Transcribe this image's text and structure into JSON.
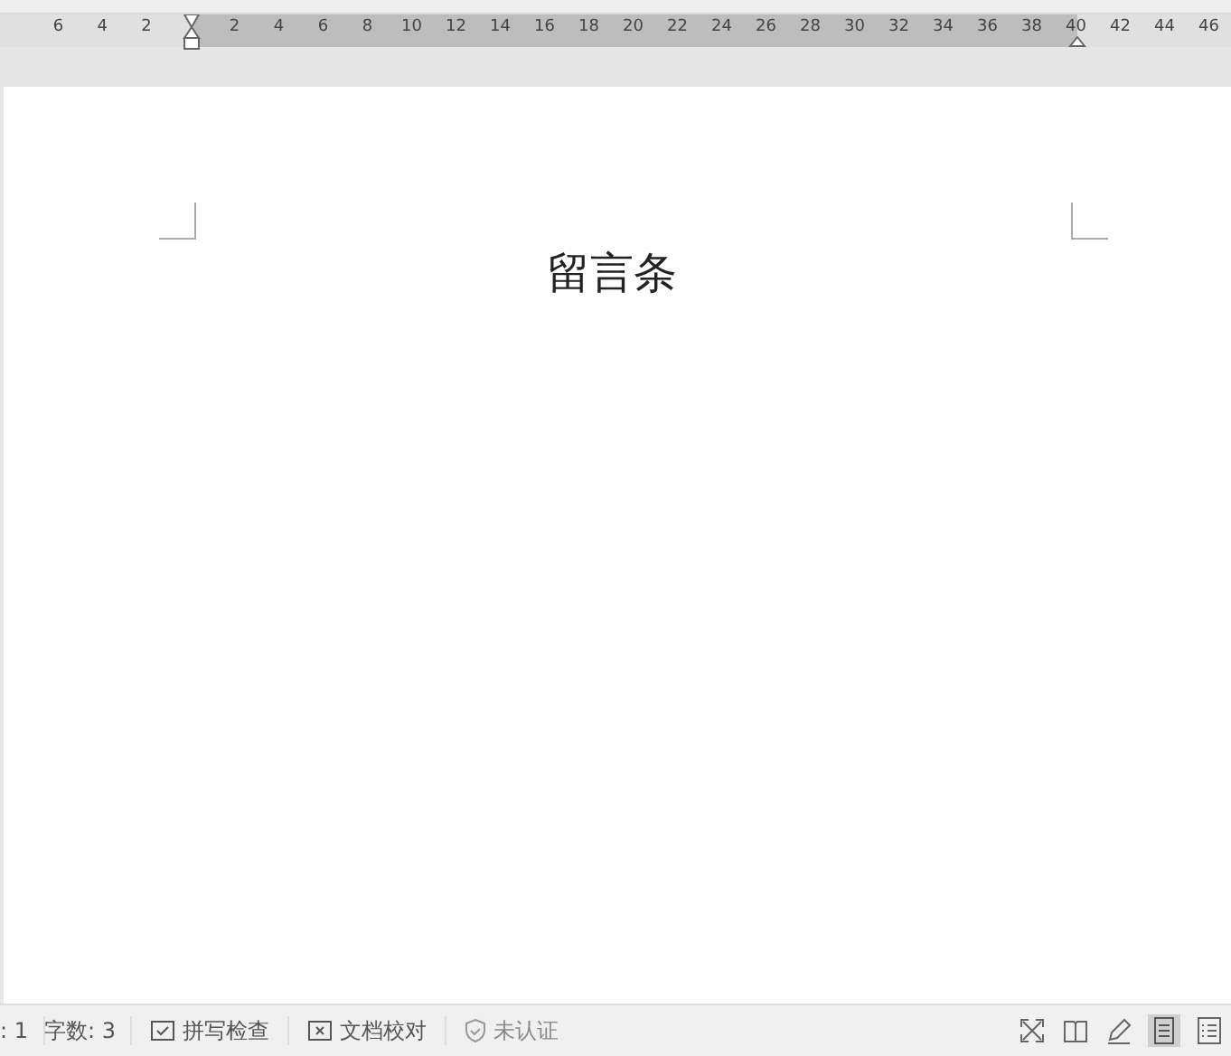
{
  "ruler": {
    "left_labels": [
      "6",
      "4",
      "2"
    ],
    "right_labels": [
      "2",
      "4",
      "6",
      "8",
      "10",
      "12",
      "14",
      "16",
      "18",
      "20",
      "22",
      "24",
      "26",
      "28",
      "30",
      "32",
      "34",
      "36",
      "38",
      "40",
      "42",
      "44",
      "46"
    ]
  },
  "document": {
    "title": "留言条"
  },
  "status_bar": {
    "items": [
      {
        "kind": "text",
        "label": ": 1"
      },
      {
        "kind": "text",
        "label": "字数: 3"
      },
      {
        "kind": "spell",
        "label": "拼写检查"
      },
      {
        "kind": "proof",
        "label": "文档校对"
      },
      {
        "kind": "cert",
        "label": "未认证"
      }
    ]
  }
}
